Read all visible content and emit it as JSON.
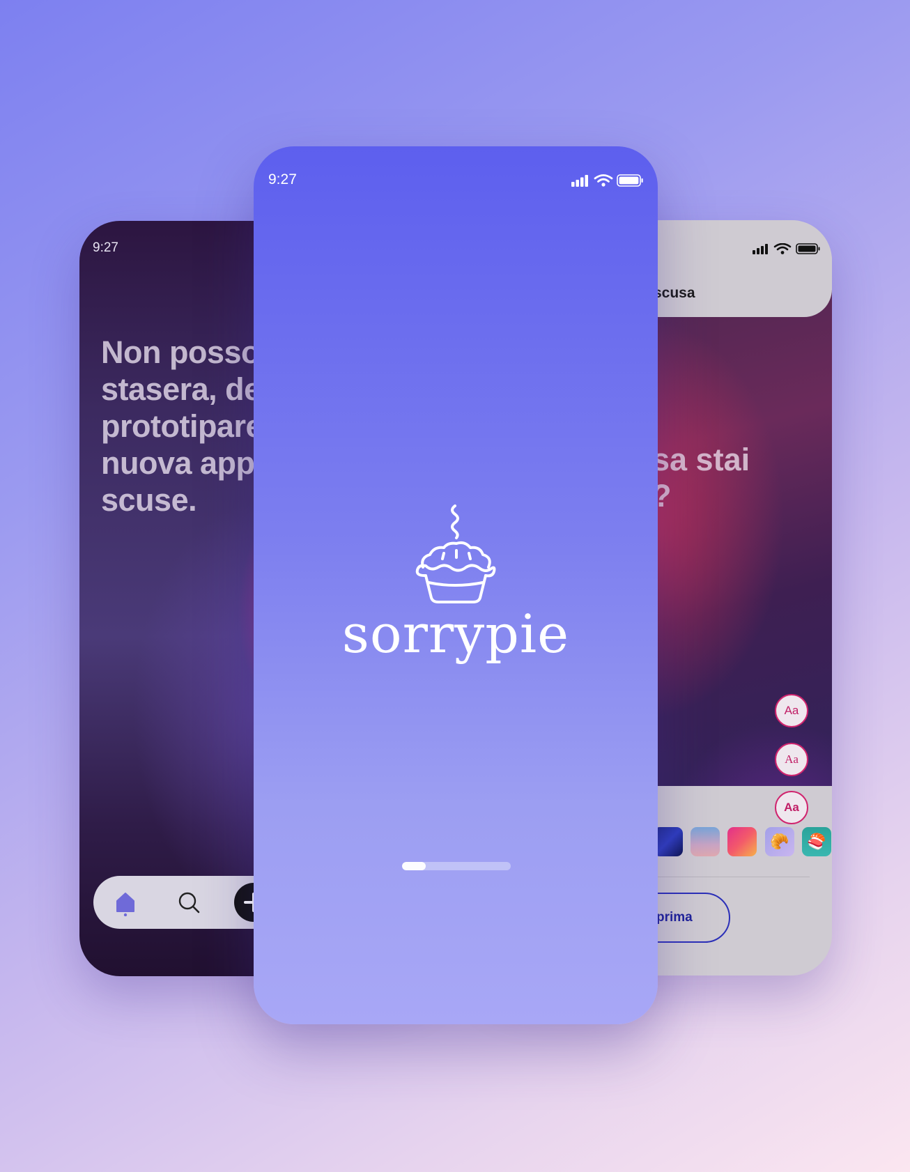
{
  "left_phone": {
    "status_time": "9:27",
    "excuse_text": "Non posso\nstasera, de\nprototipare\nnuova app\nscuse.",
    "nav": {
      "home_icon": "home-icon",
      "search_icon": "search-icon",
      "add_icon": "add-icon"
    }
  },
  "center_phone": {
    "status_time": "9:27",
    "status_icons": [
      "signal-icon",
      "wifi-icon",
      "battery-icon"
    ],
    "brand_name": "sorrypie",
    "logo_icon": "pie-logo-icon",
    "loading_progress": 0.22
  },
  "right_phone": {
    "status_icons": [
      "signal-icon",
      "wifi-icon",
      "battery-icon"
    ],
    "header_title": "scusa",
    "image_text": "sa stai\n?",
    "font_buttons": [
      {
        "label": "Aa",
        "style": "sans"
      },
      {
        "label": "Aa",
        "style": "serif"
      },
      {
        "label": "Aa",
        "style": "bold"
      }
    ],
    "backgrounds": [
      {
        "name": "blue-wave-background",
        "emoji": ""
      },
      {
        "name": "sky-gradient-background",
        "emoji": ""
      },
      {
        "name": "pink-gradient-background",
        "emoji": ""
      },
      {
        "name": "croissant-background",
        "emoji": "🥐"
      },
      {
        "name": "sushi-background",
        "emoji": "🍣"
      }
    ],
    "action_button": "prima"
  },
  "colors": {
    "brand_purple": "#5d5fee",
    "accent_pink": "#d0246e",
    "button_blue": "#2b2fb8"
  }
}
